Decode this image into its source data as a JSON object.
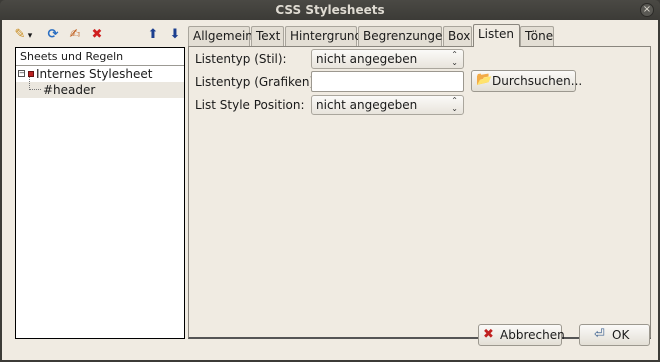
{
  "window": {
    "title": "CSS Stylesheets",
    "close_glyph": "×"
  },
  "toolbar": {
    "icons": [
      {
        "name": "open-stylesheet-icon",
        "glyph": "✎",
        "color": "#c78a1a"
      },
      {
        "name": "dropdown-arrow-icon",
        "glyph": "▾",
        "color": "#333333"
      },
      {
        "name": "refresh-icon",
        "glyph": "⟳",
        "color": "#2a6ec2"
      },
      {
        "name": "edit-rule-icon",
        "glyph": "✍",
        "color": "#c06020"
      },
      {
        "name": "delete-icon",
        "glyph": "✖",
        "color": "#d02020"
      },
      {
        "name": "move-up-icon",
        "glyph": "⬆",
        "color": "#1c3f8f"
      },
      {
        "name": "move-down-icon",
        "glyph": "⬇",
        "color": "#1c3f8f"
      }
    ]
  },
  "tree": {
    "header": "Sheets und Regeln",
    "items": [
      {
        "label": "Internes Stylesheet",
        "expander": "−"
      },
      {
        "label": "#header"
      }
    ]
  },
  "tabs": [
    {
      "label": "Allgemein"
    },
    {
      "label": "Text"
    },
    {
      "label": "Hintergrund"
    },
    {
      "label": "Begrenzungen"
    },
    {
      "label": "Box"
    },
    {
      "label": "Listen"
    },
    {
      "label": "Töne"
    }
  ],
  "active_tab": "Listen",
  "form": {
    "list_type_label": "Listentyp (Stil):",
    "list_type_value": "nicht angegeben",
    "list_image_label": "Listentyp (Grafiken):",
    "list_image_value": "",
    "browse_label": "Durchsuchen...",
    "list_position_label": "List Style Position:",
    "list_position_value": "nicht angegeben"
  },
  "buttons": {
    "cancel_label": "Abbrechen",
    "ok_label": "OK"
  },
  "colors": {
    "titlebar": "#3c3b37",
    "dialog_bg": "#f0ebe2",
    "cancel_icon": "#c02020",
    "ok_icon": "#3a5f8f"
  }
}
